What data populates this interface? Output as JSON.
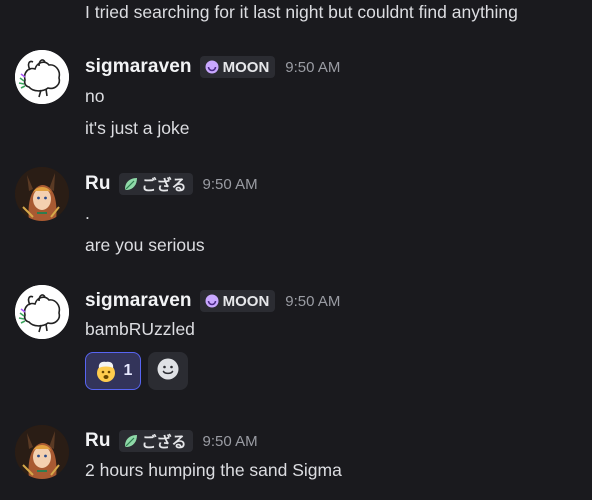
{
  "messages": [
    {
      "text": "I tried searching for it last night but couldnt find anything"
    },
    {
      "author": "sigmaraven",
      "tag_icon": "moon-icon",
      "tag": "MOON",
      "time": "9:50 AM",
      "lines": [
        "no",
        "it's just a joke"
      ]
    },
    {
      "author": "Ru",
      "tag_icon": "leaf-icon",
      "tag": "ござる",
      "time": "9:50 AM",
      "lines": [
        ".",
        "are you serious"
      ]
    },
    {
      "author": "sigmaraven",
      "tag_icon": "moon-icon",
      "tag": "MOON",
      "time": "9:50 AM",
      "lines": [
        "bambRUzzled"
      ],
      "reaction": {
        "emoji": "exploding-head-icon",
        "count": "1"
      }
    },
    {
      "author": "Ru",
      "tag_icon": "leaf-icon",
      "tag": "ござる",
      "time": "9:50 AM",
      "lines": [
        "2 hours humping the sand Sigma"
      ]
    }
  ],
  "add_reaction_icon": "add-reaction-icon",
  "colors": {
    "background": "#1a1a1e",
    "reaction_accent": "#5865f2",
    "timestamp": "#9a9ca3"
  }
}
